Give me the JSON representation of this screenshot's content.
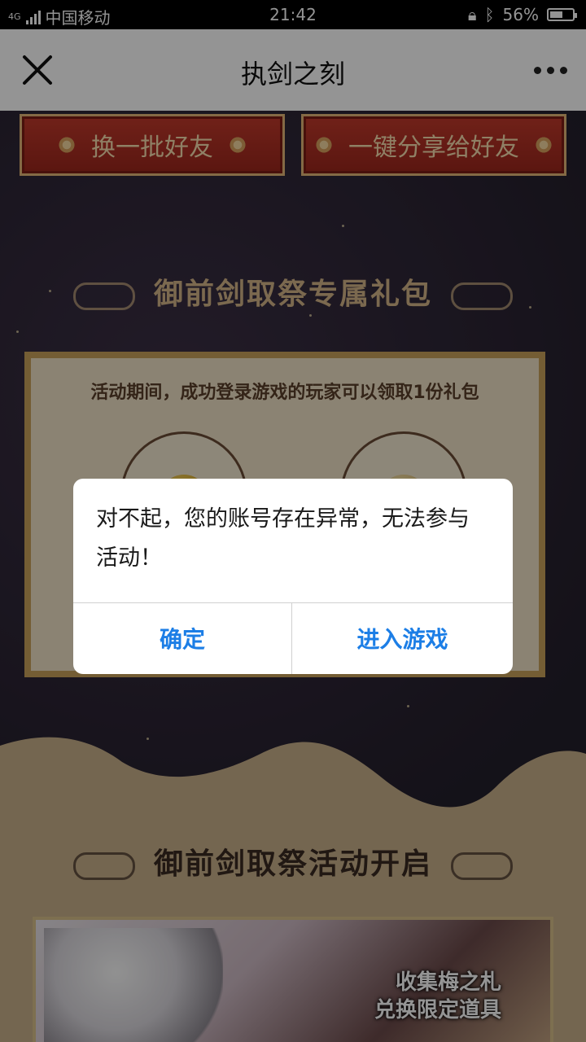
{
  "status_bar": {
    "network": "4G",
    "carrier": "中国移动",
    "time": "21:42",
    "battery": "56%",
    "battery_level": 0.56
  },
  "nav": {
    "title": "执剑之刻",
    "close_icon": "close-icon",
    "more_icon": "more-dots-icon"
  },
  "page": {
    "buttons": {
      "refresh_friends": "换一批好友",
      "share_friends": "一键分享给好友"
    },
    "gift_section": {
      "title": "御前剑取祭专属礼包",
      "description": "活动期间，成功登录游戏的玩家可以领取1份礼包"
    },
    "event_section": {
      "title": "御前剑取祭活动开启",
      "caption_line1": "收集梅之札",
      "caption_line2": "兑换限定道具"
    }
  },
  "dialog": {
    "message": "对不起，您的账号存在异常，无法参与活动！",
    "confirm_label": "确定",
    "enter_game_label": "进入游戏"
  },
  "colors": {
    "accent_blue": "#1c7ee6",
    "button_red": "#b2301f",
    "gold": "#c8a15a"
  }
}
